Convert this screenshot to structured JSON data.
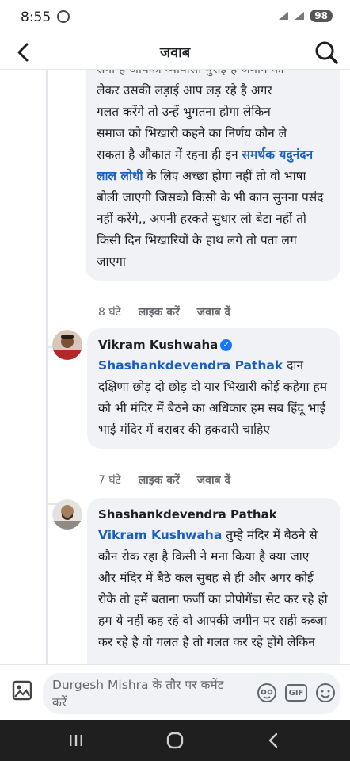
{
  "status_bar": {
    "time": "8:55",
    "battery": "98"
  },
  "header": {
    "title": "जवाब"
  },
  "comments": [
    {
      "lines": [
        "लेकर उसकी लड़ाई आप लड़ रहे है अगर",
        "गलत करेंगे तो उन्हें भुगतना होगा लेकिन",
        "समाज को भिखारी कहने का निर्णय कौन ले",
        "सकता है औकात में रहना ही इन "
      ],
      "cut_line": "सना ह आपका व्यापासा युराइ ह जमान का",
      "tag": "समर्थक यदुनंदन लाल लोधी",
      "rest": "के लिए अच्छा होगा नहीं तो वो भाषा बोली जाएगी जिसको किसी के भी कान सुनना पसंद नहीं करेंगे,, अपनी हरकते सुधार लो बेटा नहीं तो किसी दिन भिखारियों के हाथ लगे तो पता लग जाएगा",
      "time": "8 घंटे",
      "like": "लाइक करें",
      "reply": "जवाब दें"
    },
    {
      "author": "Vikram Kushwaha",
      "tag": "Shashankdevendra Pathak",
      "text": "दान दक्षिणा छोड़ दो छोड़ दो यार भिखारी कोई कहेगा हम को भी मंदिर में बैठने का अधिकार  हम सब हिंदू भाई भाई मंदिर में बराबर की हकदारी चाहिए",
      "time": "7 घंटे",
      "like": "लाइक करें",
      "reply": "जवाब दें"
    },
    {
      "author": "Shashankdevendra Pathak",
      "tag": "Vikram Kushwaha",
      "text": "तुम्हे मंदिर में बैठने से कौन रोक रहा है किसी ने मना किया है क्या जाए और मंदिर में बैठे कल सुबह से ही और अगर कोई रोके तो हमें बताना फर्जी का प्रोपोगेंडा सेट कर रहे हो हम ये नहीं कह रहे वो आपकी जमीन पर सही कब्जा कर रहे है वो गलत है तो गलत कर रहे होंगे लेकिन"
    }
  ],
  "composer": {
    "placeholder": "Durgesh Mishra के तौर पर कमेंट करें"
  },
  "icons": {
    "back": "back-arrow-icon",
    "search": "search-icon",
    "photo": "photo-icon",
    "avatar_face": "avatar-face-icon",
    "gif": "GIF",
    "emoji": "emoji-icon"
  },
  "colors": {
    "tag": "#1a5fc2",
    "verified": "#1877f2",
    "bubble": "#f0f2f5",
    "navbar": "#1f1f1f"
  }
}
